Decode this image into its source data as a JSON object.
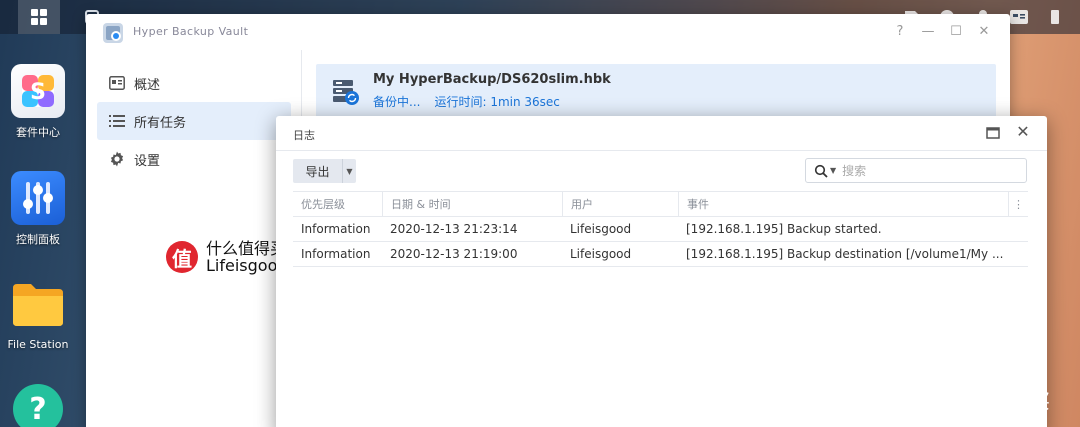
{
  "desktop": {
    "icons": [
      {
        "label": "套件中心",
        "icon": "package-center-icon"
      },
      {
        "label": "控制面板",
        "icon": "control-panel-icon"
      },
      {
        "label": "File Station",
        "icon": "file-station-icon"
      },
      {
        "label": "",
        "icon": "help-icon"
      }
    ]
  },
  "hyper_backup_vault": {
    "title": "Hyper Backup Vault",
    "controls": {
      "help": "?",
      "minimize": "—",
      "maximize": "☐",
      "close": "✕"
    },
    "sidebar": {
      "items": [
        {
          "label": "概述",
          "icon": "overview-icon",
          "active": false
        },
        {
          "label": "所有任务",
          "icon": "list-icon",
          "active": true
        },
        {
          "label": "设置",
          "icon": "gear-icon",
          "active": false
        }
      ]
    },
    "task": {
      "name": "My HyperBackup/DS620slim.hbk",
      "status": "备份中...",
      "runtime_label": "运行时间:",
      "runtime_value": "1min 36sec"
    }
  },
  "log_window": {
    "title": "日志",
    "close": "✕",
    "toolbar": {
      "export_label": "导出",
      "search_placeholder": "搜索"
    },
    "table": {
      "columns": [
        "优先层级",
        "日期 & 时间",
        "用户",
        "事件",
        "⋮"
      ],
      "rows": [
        [
          "Information",
          "2020-12-13 21:23:14",
          "Lifeisgood",
          "[192.168.1.195] Backup started."
        ],
        [
          "Information",
          "2020-12-13 21:19:00",
          "Lifeisgood",
          "[192.168.1.195] Backup destination [/volume1/My ..."
        ]
      ]
    }
  },
  "watermark": {
    "badge": "值",
    "left_line1": "什么值得买",
    "left_line2": "Lifeisgood",
    "right_text": "什么值得买"
  },
  "colors": {
    "accent": "#1a74d8",
    "selected_bg": "#e4eefb",
    "brand_red": "#e0262f"
  }
}
